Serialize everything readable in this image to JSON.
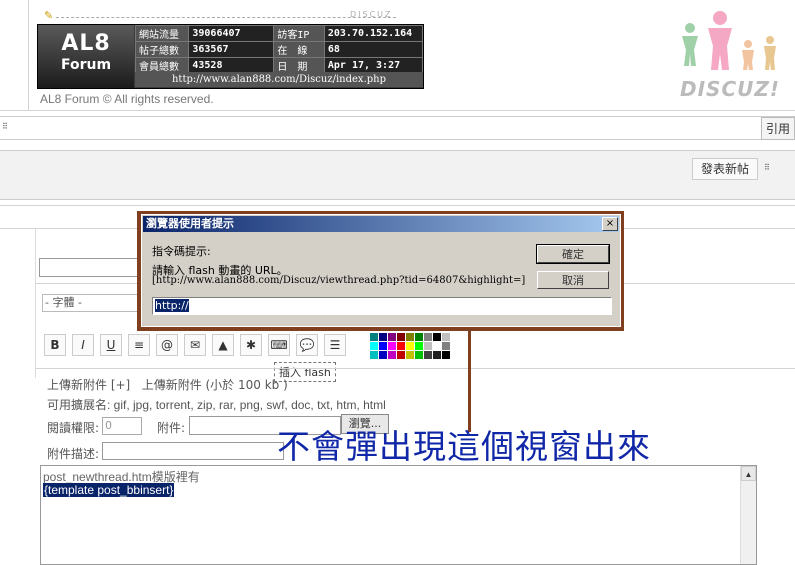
{
  "banner": {
    "logo_line1": "AL8",
    "logo_line2": "Forum",
    "brand_small": "DISCUZ",
    "stats": [
      {
        "label": "網站流量",
        "value": "39066407",
        "label2": "訪客IP",
        "value2": "203.70.152.164"
      },
      {
        "label": "帖子總數",
        "value": "363567",
        "label2": "在　線",
        "value2": "68"
      },
      {
        "label": "會員總數",
        "value": "43528",
        "label2": "日　期",
        "value2": "Apr 17, 3:27"
      }
    ],
    "url": "http://www.alan888.com/Discuz/index.php"
  },
  "copyright": "AL8 Forum © All rights reserved.",
  "discuz_logo_text": "DISCUZ!",
  "thread_bar": {
    "quote_label": "引用"
  },
  "toolbar": {
    "new_post_label": "發表新帖"
  },
  "editor": {
    "font_select_value": "- 字體 -",
    "buttons": [
      {
        "name": "bold-button",
        "label": "B"
      },
      {
        "name": "italic-button",
        "label": "I"
      },
      {
        "name": "underline-button",
        "label": "U"
      },
      {
        "name": "align-button",
        "label": "≡"
      },
      {
        "name": "link-button",
        "label": "@"
      },
      {
        "name": "email-button",
        "label": "✉"
      },
      {
        "name": "image-button",
        "label": "▲"
      },
      {
        "name": "flash-button",
        "label": "✱"
      },
      {
        "name": "code-button",
        "label": "⌨"
      },
      {
        "name": "quote-button",
        "label": "💬"
      },
      {
        "name": "list-button",
        "label": "☰"
      }
    ],
    "tooltip": "插入 flash",
    "palette": [
      "#008080",
      "#000080",
      "#800080",
      "#800000",
      "#808000",
      "#008000",
      "#808080",
      "#000000",
      "#c0c0c0",
      "#00ffff",
      "#0000ff",
      "#ff00ff",
      "#ff0000",
      "#ffff00",
      "#00ff00",
      "#c0c0c0",
      "#ffffff",
      "#808080",
      "#00c0c0",
      "#0000c0",
      "#c000c0",
      "#c00000",
      "#c0c000",
      "#00c000",
      "#404040",
      "#202020",
      "#000000"
    ]
  },
  "attachments": {
    "upload_link": "上傳新附件 [+]",
    "upload_hint": "上傳新附件 (小於 100 kb )",
    "extensions": "可用擴展名: gif, jpg, torrent, zip, rar, png, swf, doc, txt, htm, html",
    "perm_label": "閱讀權限:",
    "perm_value": "0",
    "attach_label": "附件:",
    "browse_label": "瀏覽...",
    "desc_label": "附件描述:"
  },
  "message": {
    "line1": "post_newthread.htm模版裡有",
    "line2": "{template post_bbinsert}"
  },
  "dialog": {
    "title": "瀏覽器使用者提示",
    "close": "×",
    "prompt_heading": "指令碼提示:",
    "prompt_text": "請輸入 flash 動畫的 URL。",
    "prompt_source": "[http://www.alan888.com/Discuz/viewthread.php?tid=64807&highlight=]",
    "ok_label": "確定",
    "cancel_label": "取消",
    "input_value": "http://"
  },
  "annotation": {
    "caption": "不會彈出現這個視窗出來"
  },
  "colors": {
    "dialog_border": "#804020",
    "caption": "#1028a8",
    "title_start": "#0a246a",
    "title_end": "#a6caf0"
  }
}
